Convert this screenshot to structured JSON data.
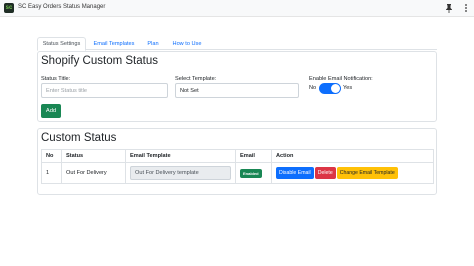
{
  "window": {
    "title": "SC Easy Orders Status Manager",
    "app_icon_letters": "sc",
    "pin_icon": "pin-icon",
    "more_icon": "more-vertical-icon"
  },
  "tabs": [
    {
      "label": "Status Settings",
      "active": true
    },
    {
      "label": "Email Templates",
      "active": false
    },
    {
      "label": "Plan",
      "active": false
    },
    {
      "label": "How to Use",
      "active": false
    }
  ],
  "form": {
    "title": "Shopify Custom Status",
    "status_title_label": "Status Title:",
    "status_title_placeholder": "Enter Status title",
    "template_label": "Select Template:",
    "template_value": "Not Set",
    "email_notification_label": "Enable Email Notification:",
    "toggle_off_label": "No",
    "toggle_on_label": "Yes",
    "add_button": "Add"
  },
  "status_list": {
    "title": "Custom Status",
    "columns": [
      "No",
      "Status",
      "Email Template",
      "Email",
      "Action"
    ],
    "rows": [
      {
        "no": "1",
        "status": "Out For Delivery",
        "email_template": "Out For Delivery template",
        "email_badge": "Enabled",
        "actions": {
          "disable": "Disable Email",
          "delete": "Delete",
          "change": "Change Email Template"
        }
      }
    ]
  },
  "colors": {
    "primary": "#0d6efd",
    "success": "#198754",
    "danger": "#dc3545",
    "warning": "#ffc107"
  }
}
